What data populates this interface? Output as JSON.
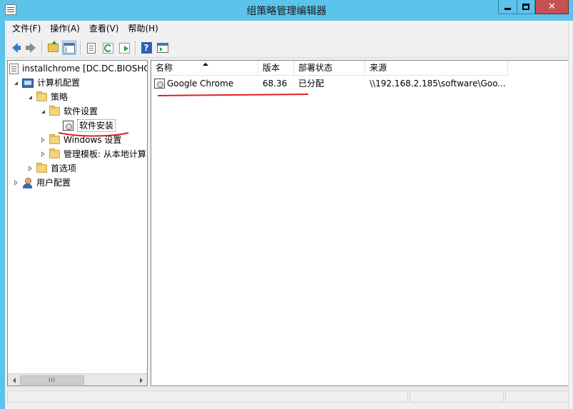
{
  "window": {
    "title": "组策略管理编辑器",
    "close_glyph": "✕"
  },
  "menu": {
    "items": [
      {
        "label": "文件(F)"
      },
      {
        "label": "操作(A)"
      },
      {
        "label": "查看(V)"
      },
      {
        "label": "帮助(H)"
      }
    ]
  },
  "toolbar": {
    "icons": [
      "back-arrow-icon",
      "forward-arrow-icon",
      "up-folder-icon",
      "show-tree-icon",
      "properties-doc-icon",
      "refresh-icon",
      "export-list-icon",
      "help-icon",
      "show-action-pane-icon"
    ],
    "help_glyph": "?"
  },
  "tree": {
    "root": "installchrome [DC.DC.BIOSHO",
    "computer_config": "计算机配置",
    "policies": "策略",
    "software_settings": "软件设置",
    "software_install": "软件安装",
    "windows_settings": "Windows 设置",
    "admin_templates": "管理模板: 从本地计算",
    "preferences": "首选项",
    "user_config": "用户配置"
  },
  "scrollbar": {
    "thumb_grip": "III"
  },
  "list": {
    "columns": [
      "名称",
      "版本",
      "部署状态",
      "来源"
    ],
    "rows": [
      {
        "name": "Google Chrome",
        "version": "68.36",
        "status": "已分配",
        "source": "\\\\192.168.2.185\\software\\Goo..."
      }
    ]
  },
  "colors": {
    "title_bar": "#5cc3ea",
    "close_button": "#c75050",
    "annotation": "#e02020"
  }
}
